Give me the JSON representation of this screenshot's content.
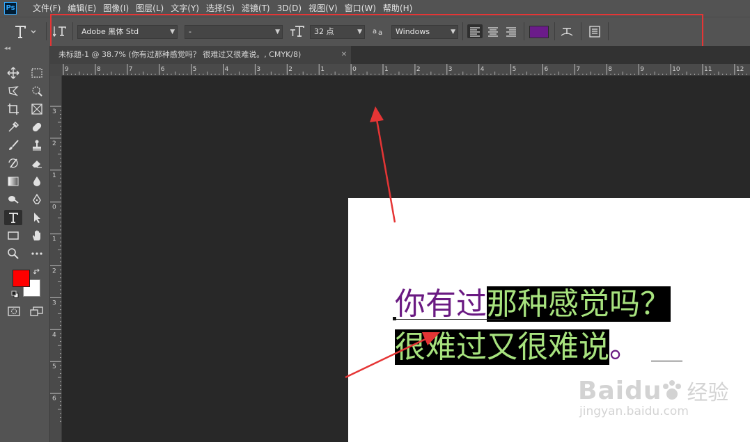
{
  "app": {
    "logo_text": "Ps"
  },
  "menubar": {
    "items": [
      "文件(F)",
      "编辑(E)",
      "图像(I)",
      "图层(L)",
      "文字(Y)",
      "选择(S)",
      "滤镜(T)",
      "3D(D)",
      "视图(V)",
      "窗口(W)",
      "帮助(H)"
    ]
  },
  "options_bar": {
    "font_family": "Adobe 黑体 Std",
    "font_style": "-",
    "font_size": "32 点",
    "anti_alias": "Windows",
    "text_color": "#6b1b8a"
  },
  "document": {
    "tab_title": "未标题-1 @ 38.7% (你有过那种感觉吗？ 很难过又很难说。, CMYK/8)",
    "text": {
      "line1_plain": "你有过",
      "line1_selected": "那种感觉吗？",
      "line2_selected": "很难过又很难说",
      "line2_trailing": "。"
    }
  },
  "rulers": {
    "top_labels": [
      "9",
      "8",
      "7",
      "6",
      "5",
      "4",
      "3",
      "2",
      "1",
      "0",
      "1",
      "2",
      "3",
      "4",
      "5",
      "6",
      "7",
      "8",
      "9",
      "10",
      "11",
      "12"
    ],
    "left_labels": [
      "3",
      "2",
      "1",
      "0",
      "1",
      "2",
      "3",
      "4",
      "5",
      "6"
    ]
  },
  "colors": {
    "foreground": "#ff0000",
    "background": "#ffffff",
    "highlight": "#e53535",
    "selected_text": "#a7e27e",
    "text_purple": "#6a1a82"
  },
  "watermark": {
    "brand": "Baidu",
    "title": "经验",
    "url": "jingyan.baidu.com"
  }
}
